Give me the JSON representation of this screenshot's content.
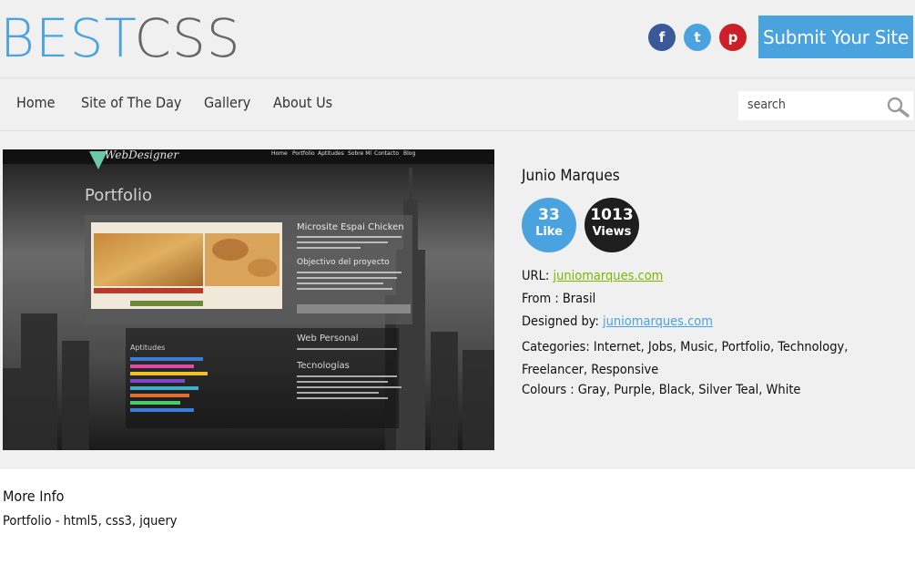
{
  "header": {
    "logo_part1": "BEST",
    "logo_part2": "CSS",
    "submit_label": "Submit Your Site",
    "social": [
      "facebook-icon",
      "twitter-icon",
      "pinterest-icon"
    ],
    "social_glyphs": {
      "facebook": "f",
      "twitter": "t",
      "pinterest": "p"
    }
  },
  "nav": {
    "items": [
      "Home",
      "Site of The Day",
      "Gallery",
      "About Us"
    ],
    "search_placeholder": "search"
  },
  "site": {
    "name": "Junio Marques",
    "likes_count": "33",
    "likes_label": "Like",
    "views_count": "1013",
    "views_label": "Views",
    "url_label": "URL:",
    "url": "juniomarques.com",
    "from": "From : Brasil",
    "designed_label": "Designed by:",
    "designed_by": "juniomarques.com",
    "categories": "Categories: Internet, Jobs, Music, Portfolio, Technology, Freelancer, Responsive",
    "colours": "Colours : Gray, Purple, Black, Silver Teal, White"
  },
  "preview": {
    "brand": "WebDesigner",
    "menu": [
      "Home",
      "Portfolio",
      "Aptitudes",
      "Sobre Mí",
      "Contacto",
      "Blog"
    ],
    "heading": "Portfolio",
    "card_title": "Microsite Espai Chicken",
    "card_subtitle": "Objectivo del proyecto",
    "web_personal": "Web Personal",
    "tech": "Tecnologías",
    "aptitudes": "Aptitudes"
  },
  "more": {
    "title": "More Info",
    "text": "Portfolio - html5, css3, jquery"
  },
  "colors": {
    "accent": "#4aa3df",
    "green_link": "#7ab800",
    "facebook": "#3b5998",
    "pinterest": "#cb2027",
    "panel_bg": "#f0f0f0"
  }
}
